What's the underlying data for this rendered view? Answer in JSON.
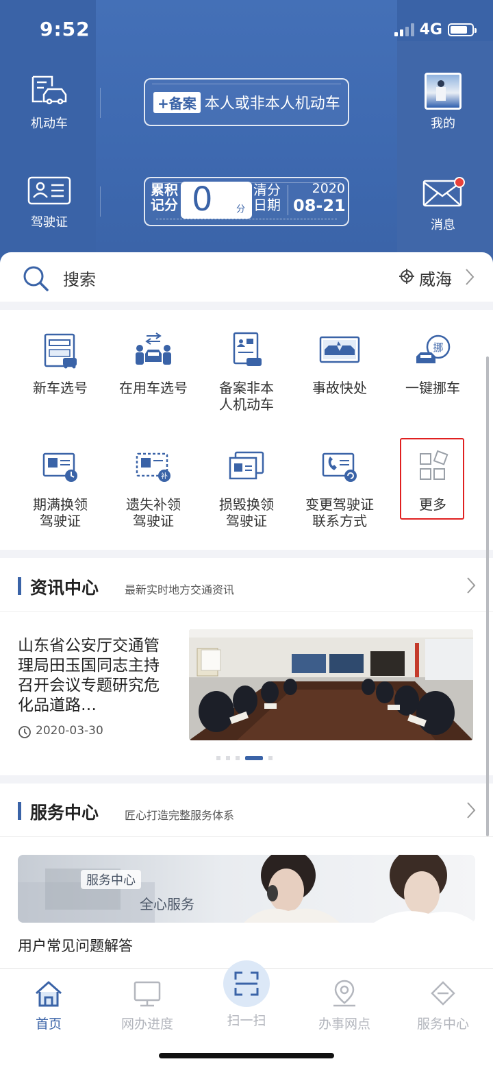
{
  "status_bar": {
    "time": "9:52",
    "network": "4G"
  },
  "header": {
    "vehicle_label": "机动车",
    "license_label": "驾驶证",
    "me_label": "我的",
    "messages_label": "消息",
    "register_badge": "+备案",
    "register_text": "本人或非本人机动车",
    "points_label": "累积记分",
    "points_value": "0",
    "points_unit": "分",
    "clear_label": "清分日期",
    "clear_year": "2020",
    "clear_date": "08-21",
    "message_dot_color": "#e8413a"
  },
  "search": {
    "placeholder": "搜索",
    "location": "威海"
  },
  "services": [
    {
      "label": "新车选号",
      "icon": "new-car-plate-icon"
    },
    {
      "label": "在用车选号",
      "icon": "used-car-plate-icon"
    },
    {
      "label": "备案非本人机动车",
      "label_line1": "备案非本",
      "label_line2": "人机动车",
      "icon": "register-vehicle-icon"
    },
    {
      "label": "事故快处",
      "icon": "accident-icon"
    },
    {
      "label": "一键挪车",
      "icon": "move-car-icon"
    },
    {
      "label": "期满换领驾驶证",
      "label_line1": "期满换领",
      "label_line2": "驾驶证",
      "icon": "renew-license-icon"
    },
    {
      "label": "遗失补领驾驶证",
      "label_line1": "遗失补领",
      "label_line2": "驾驶证",
      "icon": "lost-license-icon"
    },
    {
      "label": "损毁换领驾驶证",
      "label_line1": "损毁换领",
      "label_line2": "驾驶证",
      "icon": "damaged-license-icon"
    },
    {
      "label": "变更驾驶证联系方式",
      "label_line1": "变更驾驶证",
      "label_line2": "联系方式",
      "icon": "change-contact-icon"
    },
    {
      "label": "更多",
      "icon": "more-grid-icon"
    }
  ],
  "news": {
    "title": "资讯中心",
    "subtitle": "最新实时地方交通资讯",
    "headline": "山东省公安厅交通管理局田玉国同志主持召开会议专题研究危化品道路…",
    "date": "2020-03-30",
    "carousel_count": 5,
    "carousel_active": 4
  },
  "service_center": {
    "title": "服务中心",
    "subtitle": "匠心打造完整服务体系",
    "banner_tag": "服务中心",
    "banner_text": "全心服务",
    "faq": "用户常见问题解答"
  },
  "tabbar": {
    "home": "首页",
    "progress": "网办进度",
    "scan": "扫一扫",
    "outlets": "办事网点",
    "service": "服务中心",
    "active_color": "#3a63a7",
    "inactive_color": "#b3b6bd"
  },
  "colors": {
    "brand_blue": "#3a63a7",
    "highlight_red": "#e02020"
  }
}
